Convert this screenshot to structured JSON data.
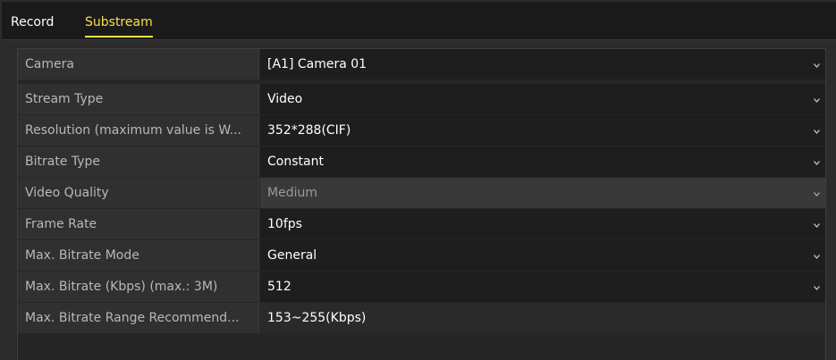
{
  "tabs": [
    {
      "label": "Record"
    },
    {
      "label": "Substream"
    }
  ],
  "rows": [
    {
      "label": "Camera",
      "value": "[A1] Camera 01"
    },
    {
      "label": "Stream Type",
      "value": "Video"
    },
    {
      "label": "Resolution (maximum value is W...",
      "value": "352*288(CIF)"
    },
    {
      "label": "Bitrate Type",
      "value": "Constant"
    },
    {
      "label": "Video Quality",
      "value": "Medium"
    },
    {
      "label": "Frame Rate",
      "value": "10fps"
    },
    {
      "label": "Max. Bitrate Mode",
      "value": "General"
    },
    {
      "label": "Max. Bitrate (Kbps) (max.: 3M)",
      "value": "512"
    },
    {
      "label": "Max. Bitrate Range Recommend...",
      "value": "153~255(Kbps)"
    }
  ],
  "icons": {
    "dropdown": "chevron-down-icon"
  },
  "colors": {
    "active_tab": "#f6e04a",
    "background": "#2c2c2c"
  }
}
